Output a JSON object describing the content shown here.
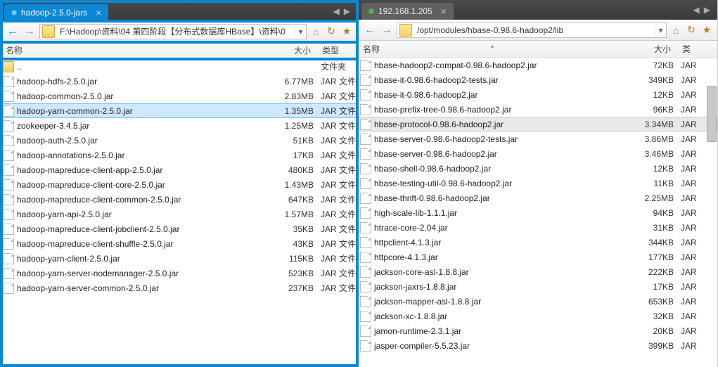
{
  "left": {
    "tab_label": "hadoop-2.5.0-jars",
    "path": "F:\\Hadoop\\资料\\04 第四阶段【分布式数据库HBase】\\资料\\0",
    "columns": {
      "name": "名称",
      "size": "大小",
      "type": "类型"
    },
    "parent_type": "文件夹",
    "selected_index": 3,
    "files": [
      {
        "name": "hadoop-hdfs-2.5.0.jar",
        "size": "6.77MB",
        "type": "JAR 文件"
      },
      {
        "name": "hadoop-common-2.5.0.jar",
        "size": "2.83MB",
        "type": "JAR 文件"
      },
      {
        "name": "hadoop-yarn-common-2.5.0.jar",
        "size": "1.35MB",
        "type": "JAR 文件"
      },
      {
        "name": "zookeeper-3.4.5.jar",
        "size": "1.25MB",
        "type": "JAR 文件"
      },
      {
        "name": "hadoop-auth-2.5.0.jar",
        "size": "51KB",
        "type": "JAR 文件"
      },
      {
        "name": "hadoop-annotations-2.5.0.jar",
        "size": "17KB",
        "type": "JAR 文件"
      },
      {
        "name": "hadoop-mapreduce-client-app-2.5.0.jar",
        "size": "480KB",
        "type": "JAR 文件"
      },
      {
        "name": "hadoop-mapreduce-client-core-2.5.0.jar",
        "size": "1.43MB",
        "type": "JAR 文件"
      },
      {
        "name": "hadoop-mapreduce-client-common-2.5.0.jar",
        "size": "647KB",
        "type": "JAR 文件"
      },
      {
        "name": "hadoop-yarn-api-2.5.0.jar",
        "size": "1.57MB",
        "type": "JAR 文件"
      },
      {
        "name": "hadoop-mapreduce-client-jobclient-2.5.0.jar",
        "size": "35KB",
        "type": "JAR 文件"
      },
      {
        "name": "hadoop-mapreduce-client-shuffle-2.5.0.jar",
        "size": "43KB",
        "type": "JAR 文件"
      },
      {
        "name": "hadoop-yarn-client-2.5.0.jar",
        "size": "115KB",
        "type": "JAR 文件"
      },
      {
        "name": "hadoop-yarn-server-nodemanager-2.5.0.jar",
        "size": "523KB",
        "type": "JAR 文件"
      },
      {
        "name": "hadoop-yarn-server-common-2.5.0.jar",
        "size": "237KB",
        "type": "JAR 文件"
      }
    ]
  },
  "right": {
    "tab_label": "192.168.1.205",
    "path": "/opt/modules/hbase-0.98.6-hadoop2/lib",
    "columns": {
      "name": "名称",
      "size": "大小",
      "type": "类"
    },
    "selected_index": 4,
    "files": [
      {
        "name": "hbase-hadoop2-compat-0.98.6-hadoop2.jar",
        "size": "72KB",
        "type": "JAR"
      },
      {
        "name": "hbase-it-0.98.6-hadoop2-tests.jar",
        "size": "349KB",
        "type": "JAR"
      },
      {
        "name": "hbase-it-0.98.6-hadoop2.jar",
        "size": "12KB",
        "type": "JAR"
      },
      {
        "name": "hbase-prefix-tree-0.98.6-hadoop2.jar",
        "size": "96KB",
        "type": "JAR"
      },
      {
        "name": "hbase-protocol-0.98.6-hadoop2.jar",
        "size": "3.34MB",
        "type": "JAR"
      },
      {
        "name": "hbase-server-0.98.6-hadoop2-tests.jar",
        "size": "3.86MB",
        "type": "JAR"
      },
      {
        "name": "hbase-server-0.98.6-hadoop2.jar",
        "size": "3.46MB",
        "type": "JAR"
      },
      {
        "name": "hbase-shell-0.98.6-hadoop2.jar",
        "size": "12KB",
        "type": "JAR"
      },
      {
        "name": "hbase-testing-util-0.98.6-hadoop2.jar",
        "size": "11KB",
        "type": "JAR"
      },
      {
        "name": "hbase-thrift-0.98.6-hadoop2.jar",
        "size": "2.25MB",
        "type": "JAR"
      },
      {
        "name": "high-scale-lib-1.1.1.jar",
        "size": "94KB",
        "type": "JAR"
      },
      {
        "name": "htrace-core-2.04.jar",
        "size": "31KB",
        "type": "JAR"
      },
      {
        "name": "httpclient-4.1.3.jar",
        "size": "344KB",
        "type": "JAR"
      },
      {
        "name": "httpcore-4.1.3.jar",
        "size": "177KB",
        "type": "JAR"
      },
      {
        "name": "jackson-core-asl-1.8.8.jar",
        "size": "222KB",
        "type": "JAR"
      },
      {
        "name": "jackson-jaxrs-1.8.8.jar",
        "size": "17KB",
        "type": "JAR"
      },
      {
        "name": "jackson-mapper-asl-1.8.8.jar",
        "size": "653KB",
        "type": "JAR"
      },
      {
        "name": "jackson-xc-1.8.8.jar",
        "size": "32KB",
        "type": "JAR"
      },
      {
        "name": "jamon-runtime-2.3.1.jar",
        "size": "20KB",
        "type": "JAR"
      },
      {
        "name": "jasper-compiler-5.5.23.jar",
        "size": "399KB",
        "type": "JAR"
      }
    ]
  }
}
